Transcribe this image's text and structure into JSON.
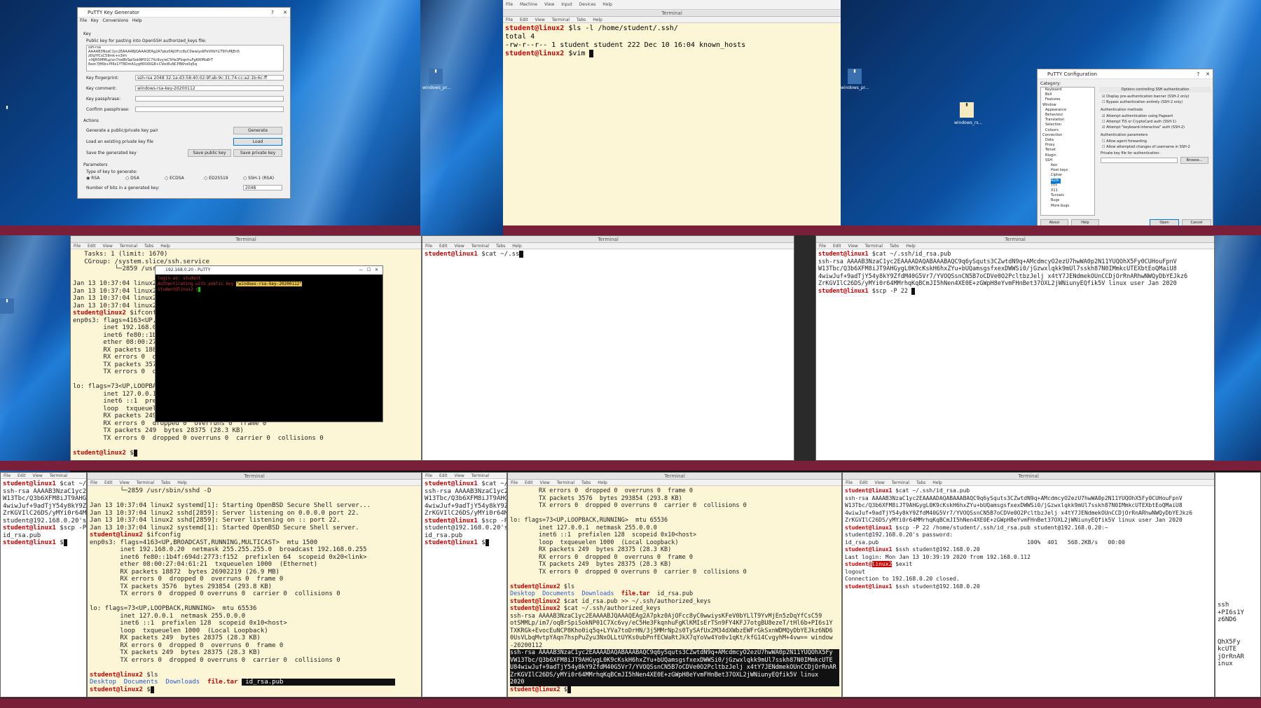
{
  "keygen": {
    "title": "PuTTY Key Generator",
    "menu": [
      "File",
      "Key",
      "Conversions",
      "Help"
    ],
    "key_section": "Key",
    "pubkey_label": "Public key for pasting into OpenSSH authorized_keys file:",
    "pubkey_text": "ssh-rsa\nAAAAB3NzaC1yc2EAAAABJQAAAQEAg2A7pkz0AjOFcc8yC0wwiysKFeV0bYLlT9YvMjEn5\nzDqYfCsC59mk+n3lm\n+Nj8i5MMLp/sn7/odBrSpiSokNP01C7Xc6vy/eC5He3FkqnhuFgKlKMIsErT\n6ezc7Jfl6b+PI6s1YT8DmA1ygf8XXRG8+CVocEuNCP8Kho0q5q",
    "fingerprint_label": "Key fingerprint:",
    "fingerprint_value": "ssh-rsa 2048 32:1a:d3:58:40:02:9f:ab:9c:31:74:cc:a2:1b:6c:ff",
    "comment_label": "Key comment:",
    "comment_value": "windows-rsa-key-20200112",
    "passphrase_label": "Key passphrase:",
    "confirm_label": "Confirm passphrase:",
    "actions_label": "Actions",
    "generate_text": "Generate a public/private key pair",
    "generate_btn": "Generate",
    "load_text": "Load an existing private key file",
    "load_btn": "Load",
    "save_text": "Save the generated key",
    "save_pub_btn": "Save public key",
    "save_priv_btn": "Save private key",
    "params_label": "Parameters",
    "type_label": "Type of key to generate:",
    "types": [
      "RSA",
      "DSA",
      "ECDSA",
      "ED25519",
      "SSH-1 (RSA)"
    ],
    "bits_label": "Number of bits in a generated key:",
    "bits_value": "2048"
  },
  "vm_menu": [
    "File",
    "Machine",
    "View",
    "Input",
    "Devices",
    "Help"
  ],
  "term_menu": [
    "File",
    "Edit",
    "View",
    "Terminal",
    "Tabs",
    "Help"
  ],
  "term_title": "Terminal",
  "top_term": {
    "lines": [
      {
        "p": "student@linux2",
        "c": " $ls -l /home/student/.ssh/"
      },
      {
        "t": "total 4"
      },
      {
        "t": "-rw-r--r-- 1 student student 222 Dec 10 16:04 known_hosts"
      },
      {
        "p": "student@linux2",
        "c": " $vim "
      }
    ]
  },
  "putty_config": {
    "title": "PuTTY Configuration",
    "category": "Category:",
    "tree": [
      "Keyboard",
      "Bell",
      "Features",
      "Window",
      "Appearance",
      "Behaviour",
      "Translation",
      "Selection",
      "Colours",
      "Connection",
      "Data",
      "Proxy",
      "Telnet",
      "Rlogin",
      "SSH",
      "Kex",
      "Host keys",
      "Cipher",
      "Auth",
      "TTY",
      "X11",
      "Tunnels",
      "Bugs",
      "More bugs"
    ],
    "heading": "Options controlling SSH authentication",
    "opt1": "Display pre-authentication banner (SSH-2 only)",
    "opt2": "Bypass authentication entirely (SSH-2 only)",
    "methods": "Authentication methods",
    "m1": "Attempt authentication using Pageant",
    "m2": "Attempt TIS or CryptoCard auth (SSH-1)",
    "m3": "Attempt \"keyboard-interactive\" auth (SSH-2)",
    "params": "Authentication parameters",
    "p1": "Allow agent forwarding",
    "p2": "Allow attempted changes of username in SSH-2",
    "pkfile": "Private key file for authentication:",
    "browse": "Browse...",
    "about": "About",
    "help": "Help",
    "open": "Open",
    "cancel": "Cancel"
  },
  "desktop_icon_label": "windows_pr...",
  "desktop_icon_label2": "windows_rs...",
  "mid_left": {
    "lines": [
      "   Tasks: 1 (limit: 1670)",
      "   CGroup: /system.slice/ssh.service",
      "           └─2859 /usr/",
      "",
      "Jan 13 10:37:04 linux2",
      "Jan 13 10:37:04 linux2",
      "Jan 13 10:37:04 linux2",
      "Jan 13 10:37:04 linux2"
    ],
    "prompt1": "student@linux2",
    "cmd1": " $ifconf",
    "lines2": [
      "enp0s3: flags=4163<UP,B",
      "        inet 192.168.0.",
      "        inet6 fe80::1b4",
      "        ether 08:00:27:",
      "        RX packets 1887",
      "        RX errors 0  dr",
      "        TX packets 3576",
      "        TX errors 0  dr",
      "",
      "lo: flags=73<UP,LOOPBACK",
      "        inet 127.0.0.1",
      "        inet6 ::1  pref",
      "        loop  txqueuele",
      "        RX packets 249",
      "        RX errors 0  dropped 0  overruns 0  frame 0",
      "        TX packets 249  bytes 28375 (28.3 KB)",
      "        TX errors 0  dropped 0 overruns 0  carrier 0  collisions 0"
    ],
    "prompt2": "student@linux2"
  },
  "putty_session": {
    "title": "192.168.0.20 - PuTTY",
    "line1": "login as: student",
    "line2a": "Authenticating with public key ",
    "line2b": "\"windows-rsa-key-20200112\"",
    "prompt": "student@linux2"
  },
  "mid_center": {
    "prompt": "student@linux1",
    "cmd": " $cat ~/.ss"
  },
  "mid_right": {
    "prompt": "student@linux1",
    "cmd": " $cat ~/.ssh/id_rsa.pub",
    "key": [
      "ssh-rsa AAAAB3NzaC1yc2EAAAADAQABAAABAQC9q6ySquts3CZwtdN9q+AMcdmcyO2ezU7hwWA0p2N11YUQOhX5Fy0CUHouFpnV",
      "W13Tbc/Q3b6XFM8iJT9AHGygL0K9cKskH6hxZYu+bUQamsgsfxexDWWSi0/jGzwxlqkk9mUl7sskh87N0IMmkcUTEXbtEoQMaiU8",
      "4wiwJuf+9adTjY54y8kY9ZfdM40G5Vr7/YVOQSsnCN5B7oCDVe0O2PcltbzJelj x4tY7JENdmekOUnCCDjOrRnARhwNWQyDbYEJkz6",
      "ZrKGVIlC26DS/yMYi0r64MMrhqKqBCmJI5hNen4XE0E+zGWpH8eYvmFHnBet37OXL2jWNiunyEQfik5V linux user Jan 2020"
    ],
    "prompt2": "student@linux1",
    "cmd2": " $scp -P 22 "
  },
  "bot1": {
    "lines": [
      {
        "p": "student@linux1",
        "c": " $cat ~/"
      },
      {
        "t": "ssh-rsa AAAAB3NzaC1yc2E"
      },
      {
        "t": "W13Tbc/Q3b6XFM8iJT9AHGy"
      },
      {
        "t": "4wiwJuf+9adTjY54y8kY9Zf"
      },
      {
        "t": "ZrKGVIlC26DS/yMYi0r64MM"
      },
      {
        "t": "student@192.168.0.20's"
      },
      {
        "p": "student@linux1",
        "c": " $scp -P"
      },
      {
        "t": "id_rsa.pub"
      },
      {
        "p": "student@linux1",
        "c": " $"
      }
    ]
  },
  "bot2": {
    "lines": [
      "        └─2859 /usr/sbin/sshd -D",
      "",
      "Jan 13 10:37:04 linux2 systemd[1]: Starting OpenBSD Secure Shell server...",
      "Jan 13 10:37:04 linux2 sshd[2859]: Server listening on 0.0.0.0 port 22.",
      "Jan 13 10:37:04 linux2 sshd[2859]: Server listening on :: port 22.",
      "Jan 13 10:37:04 linux2 systemd[1]: Started OpenBSD Secure Shell server."
    ],
    "prompt": "student@linux2",
    "cmd": " $ifconfig",
    "lines2": [
      "enp0s3: flags=4163<UP,BROADCAST,RUNNING,MULTICAST>  mtu 1500",
      "        inet 192.168.0.20  netmask 255.255.255.0  broadcast 192.168.0.255",
      "        inet6 fe80::1b4f:694d:2773:f152  prefixlen 64  scopeid 0x20<link>",
      "        ether 08:00:27:04:61:21  txqueuelen 1000  (Ethernet)",
      "        RX packets 18872  bytes 26902219 (26.9 MB)",
      "        RX errors 0  dropped 0  overruns 0  frame 0",
      "        TX packets 3576  bytes 293854 (293.8 KB)",
      "        TX errors 0  dropped 0 overruns 0  carrier 0  collisions 0",
      "",
      "lo: flags=73<UP,LOOPBACK,RUNNING>  mtu 65536",
      "        inet 127.0.0.1  netmask 255.0.0.0",
      "        inet6 ::1  prefixlen 128  scopeid 0x10<host>",
      "        loop  txqueuelen 1000  (Local Loopback)",
      "        RX packets 249  bytes 28375 (28.3 KB)",
      "        RX errors 0  dropped 0  overruns 0  frame 0",
      "        TX packets 249  bytes 28375 (28.3 KB)",
      "        TX errors 0  dropped 0 overruns 0  carrier 0  collisions 0",
      ""
    ],
    "prompt2": "student@linux2",
    "cmd2": " $ls",
    "ls": [
      "Desktop",
      "Documents",
      "Downloads"
    ],
    "ls_file": "file.tar",
    "ls_sel": " id_rsa.pub",
    "prompt3": "student@linux2"
  },
  "bot3": {
    "lines": [
      {
        "p": "student@linux1",
        "c": " $cat ~/"
      },
      {
        "t": "ssh-rsa AAAAB3NzaC1yc2E"
      },
      {
        "t": "W13Tbc/Q3b6XFM8iJT9AHGy"
      },
      {
        "t": "4wiwJuf+9adTjY54y8kY9Zf"
      },
      {
        "t": "ZrKGVIlC26DS/yMYi0r64MM"
      },
      {
        "p": "student@linux1",
        "c": " $scp -P"
      },
      {
        "t": "student@192.168.0.20's"
      },
      {
        "t": "id_rsa.pub"
      },
      {
        "p": "student@linux1",
        "c": " $"
      }
    ]
  },
  "bot4": {
    "lines": [
      "        RX errors 0  dropped 0  overruns 0  frame 0",
      "        TX packets 3576  bytes 293854 (293.8 KB)",
      "        TX errors 0  dropped 0 overruns 0  carrier 0  collisions 0",
      "",
      "lo: flags=73<UP,LOOPBACK,RUNNING>  mtu 65536",
      "        inet 127.0.0.1  netmask 255.0.0.0",
      "        inet6 ::1  prefixlen 128  scopeid 0x10<host>",
      "        loop  txqueuelen 1000  (Local Loopback)",
      "        RX packets 249  bytes 28375 (28.3 KB)",
      "        RX errors 0  dropped 0  overruns 0  frame 0",
      "        TX packets 249  bytes 28375 (28.3 KB)",
      "        TX errors 0  dropped 0 overruns 0  carrier 0  collisions 0",
      ""
    ],
    "p1": "student@linux2",
    "c1": " $ls",
    "ls": [
      "Desktop",
      "Documents",
      "Downloads"
    ],
    "ls_file": "file.tar",
    "ls_rest": "  id_rsa.pub",
    "p2": "student@linux2",
    "c2": " $cat id_rsa.pub >> ~/.ssh/authorized_keys",
    "p3": "student@linux2",
    "c3": " $cat ~/.ssh/authorized_keys",
    "auth": [
      "ssh-rsa AAAAB3NzaC1yc2EAAAABJQAAAQEAg2A7pkz0AjOFcc8yC0wwiysKFeV0bYLlT9YvMjEn5zDqYfCsC59",
      "otSMMLp/im7/oqBrSpiSokNP01C7Xc6vy/eC5He3FkqnhuFgKlKMIsErTSn9FY4KFJ7otgBU8ezeT/tHl6b+PI6s1Y",
      "TXKRGk+EvocEuNCP8Kho0iq5q+LYVa7toDrHN/3j5MMrNp2s0TySAfUx2M34dXWbzEWFrGkSxnWDMQyDbYEJkz6ND6",
      "0UsVLbqMvtpYAqn7hspPuZyu3NxOLLtUYKs0ubPnfECWaRtJkX7qYoVw4Yo0v1qKt/kfG14CvgyhM+4vw== window",
      "-20200112"
    ],
    "sel": [
      "ssh-rsa AAAAB3NzaC1yc2EAAAADAQABAAABAQC9q6ySquts3CZwtdN9q+AMcdmcyO2ezU7hwWA0p2N11YUQOhX5Fy",
      "VW13Tbc/Q3b6XFM8iJT9AHGygL0K9cKskH6hxZYu+bUQamsgsfxexDWWSi0/jGzwxlqkk9mUl7sskh87N0IMmkcUTE",
      "U84wiwJuf+9adTjY54y8kY9ZfdM40G5Vr7/YVOQSsnCN5B7oCDVe0O2PcltbzJelj x4tY7JENdmekOUnCCDjOrRnAR",
      "ZrKGVIlC26DS/yMYi0r64MMrhqKqBCmJI5hNen4XE0E+zGWpH8eYvmFHnBet37OXL2jWNiunyEQfik5V linux",
      "2020"
    ],
    "p4": "student@linux2",
    "c4": " $"
  },
  "bot5": {
    "p1": "student@linux1",
    "c1": " $cat ~/.ssh/id_rsa.pub",
    "key": [
      "ssh-rsa AAAAB3NzaC1yc2EAAAADAQABAAABAQC9q6ySquts3CZwtdN9q+AMcdmcyO2ezU7hwWA0p2N11YUQOhX5Fy0CUHouFpnV",
      "W13Tbc/Q3b6XFM8iJT9AHGygL0K9cKskH6hxZYu+bUQamsgsfxexDWWSi0/jGzwxlqkk9mUl7sskh87N0IMmkcUTEXbtEoQMaiU8",
      "4wiwJuf+9adTjY54y8kY9ZfdM40G5Vr7/YVOQSsnCN5B7oCDVe0O2PcltbzJelj x4tY7JENdmekOUnCCDjOrRnARhwNWQyDbYEJkz6",
      "ZrKGVIlC26DS/yMYi0r64MMrhqKqBCmJI5hNen4XE0E+zGWpH8eYvmFHnBet37OXL2jWNiunyEQfik5V linux user Jan 2020"
    ],
    "p2": "student@linux1",
    "c2": " $scp -P 22 /home/student/.ssh/id_rsa.pub student@192.168.0.20:~",
    "l1": "student@192.168.0.20's password:",
    "l2": "id_rsa.pub                                            100%  401   568.2KB/s   00:00",
    "p3": "student@linux1",
    "c3": " $ssh student@192.168.0.20",
    "l3": "Last login: Mon Jan 13 10:39:19 2020 from 192.168.0.112",
    "p4a": "student@",
    "p4b": "linux2",
    "c4": " $exit",
    "l4": "logout",
    "l5": "Connection to 192.168.0.20 closed.",
    "p5": "student@linux1",
    "c5": " $ssh student@192.168.0.20"
  },
  "edge_right": [
    "ssh",
    "+PI6s1Y",
    "z6ND6",
    "",
    "",
    "QhX5Fy",
    "kcUTE",
    "jOrRnAR",
    "inux",
    ""
  ]
}
